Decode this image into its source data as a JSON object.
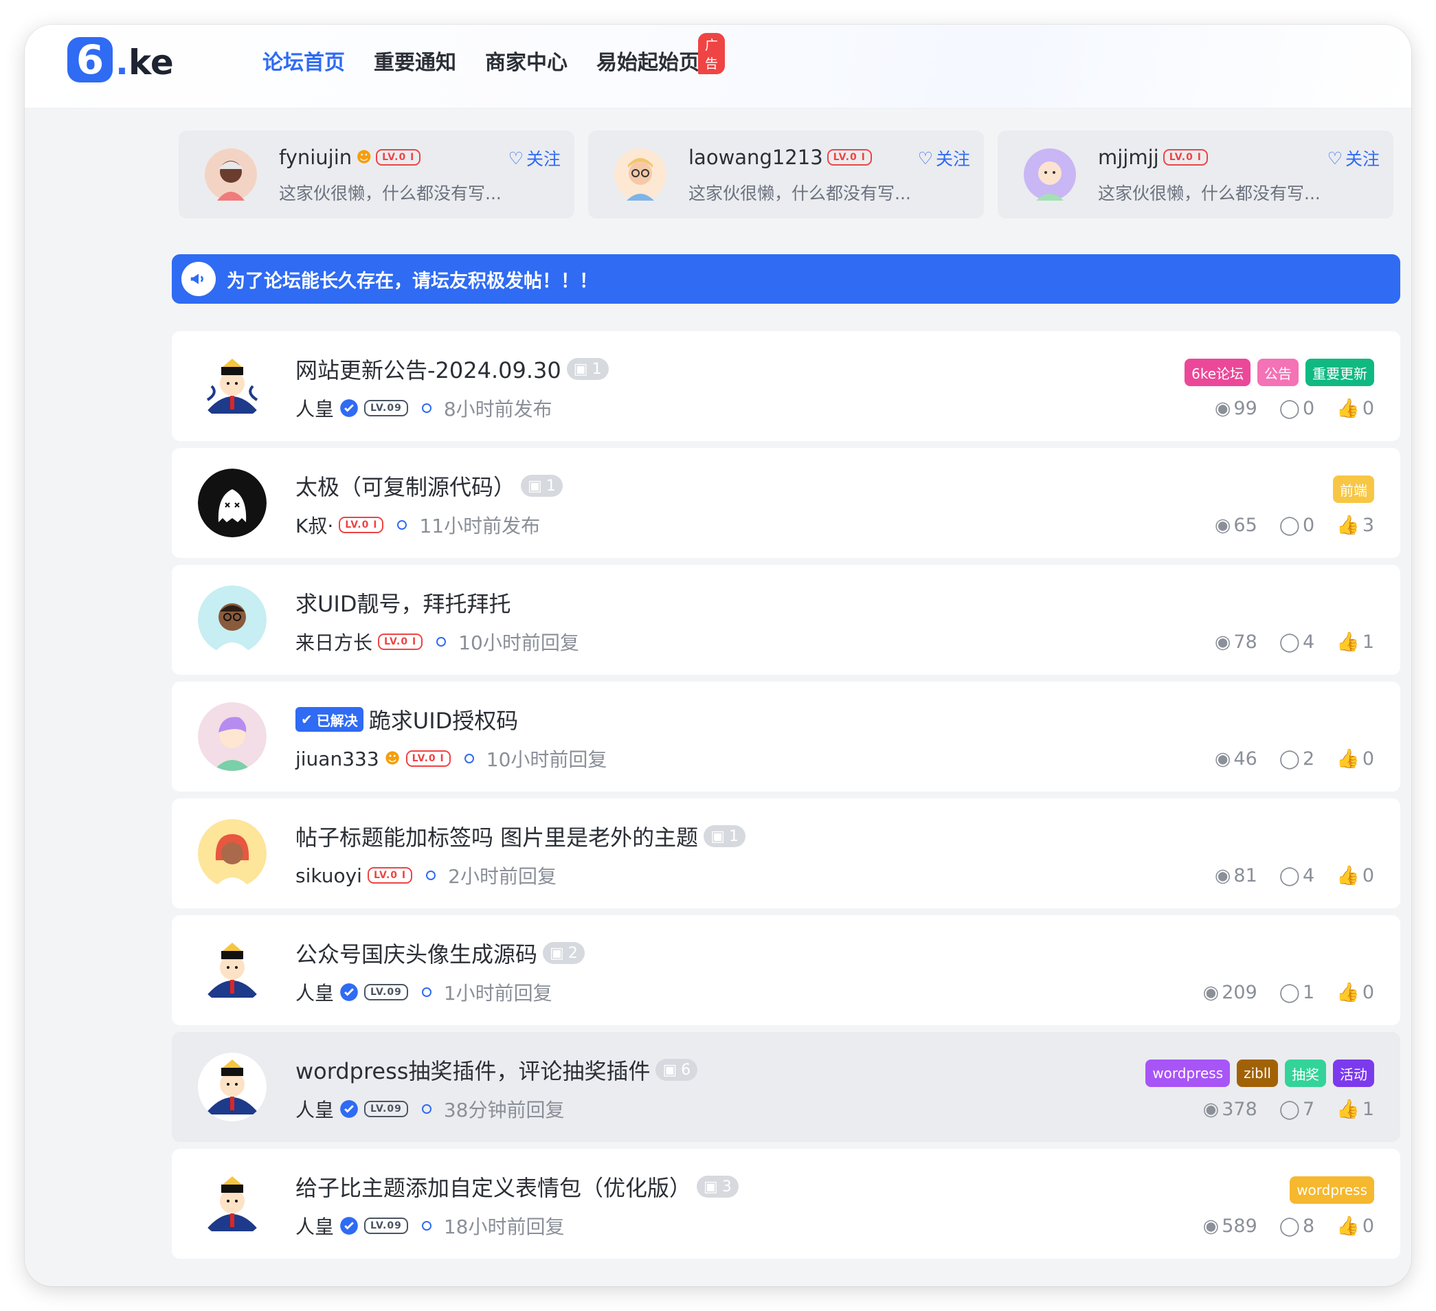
{
  "header": {
    "logo_mark": "6",
    "logo_dot": ".",
    "logo_text": "ke",
    "nav": [
      {
        "label": "论坛首页",
        "active": true
      },
      {
        "label": "重要通知"
      },
      {
        "label": "商家中心"
      },
      {
        "label": "易始起始页",
        "badge": "广告"
      }
    ]
  },
  "follow_cards": [
    {
      "name": "fyniujin",
      "level": "LV.0 I",
      "bio": "这家伙很懒，什么都没有写...",
      "follow_label": "关注"
    },
    {
      "name": "laowang1213",
      "level": "LV.0 I",
      "bio": "这家伙很懒，什么都没有写...",
      "follow_label": "关注"
    },
    {
      "name": "mjjmjj",
      "level": "LV.0 I",
      "bio": "这家伙很懒，什么都没有写...",
      "follow_label": "关注"
    }
  ],
  "notice": {
    "text": "为了论坛能长久存在，请坛友积极发帖！！！"
  },
  "posts": [
    {
      "title": "网站更新公告-2024.09.30",
      "images": "1",
      "author": "人皇",
      "level": "LV.09",
      "time": "8小时前发布",
      "tags": [
        {
          "label": "6ke论坛",
          "color": "#ec4899"
        },
        {
          "label": "公告",
          "color": "#f472b6"
        },
        {
          "label": "重要更新",
          "color": "#10b981"
        }
      ],
      "views": "99",
      "comments": "0",
      "likes": "0"
    },
    {
      "title": "太极（可复制源代码）",
      "images": "1",
      "author": "K叔·",
      "level": "LV.0 I",
      "time": "11小时前发布",
      "tags": [
        {
          "label": "前端",
          "color": "#f7c644"
        }
      ],
      "views": "65",
      "comments": "0",
      "likes": "3"
    },
    {
      "title": "求UID靓号，拜托拜托",
      "author": "来日方长",
      "level": "LV.0 I",
      "time": "10小时前回复",
      "tags": [],
      "views": "78",
      "comments": "4",
      "likes": "1"
    },
    {
      "title": "跪求UID授权码",
      "solved": "已解决",
      "author": "jiuan333",
      "level": "LV.0 I",
      "time": "10小时前回复",
      "tags": [],
      "views": "46",
      "comments": "2",
      "likes": "0"
    },
    {
      "title": "帖子标题能加标签吗 图片里是老外的主题",
      "images": "1",
      "author": "sikuoyi",
      "level": "LV.0 I",
      "time": "2小时前回复",
      "tags": [],
      "views": "81",
      "comments": "4",
      "likes": "0"
    },
    {
      "title": "公众号国庆头像生成源码",
      "images": "2",
      "author": "人皇",
      "level": "LV.09",
      "time": "1小时前回复",
      "tags": [],
      "views": "209",
      "comments": "1",
      "likes": "0"
    },
    {
      "title": "wordpress抽奖插件，评论抽奖插件",
      "images": "6",
      "author": "人皇",
      "level": "LV.09",
      "time": "38分钟前回复",
      "tags": [
        {
          "label": "wordpress",
          "color": "#a855f7"
        },
        {
          "label": "zibll",
          "color": "#a16207"
        },
        {
          "label": "抽奖",
          "color": "#34d399"
        },
        {
          "label": "活动",
          "color": "#7c3aed"
        }
      ],
      "views": "378",
      "comments": "7",
      "likes": "1",
      "highlight": true
    },
    {
      "title": "给子比主题添加自定义表情包（优化版）",
      "images": "3",
      "author": "人皇",
      "level": "LV.09",
      "time": "18小时前回复",
      "tags": [
        {
          "label": "wordpress",
          "color": "#f5b82e"
        }
      ],
      "views": "589",
      "comments": "8",
      "likes": "0"
    }
  ]
}
